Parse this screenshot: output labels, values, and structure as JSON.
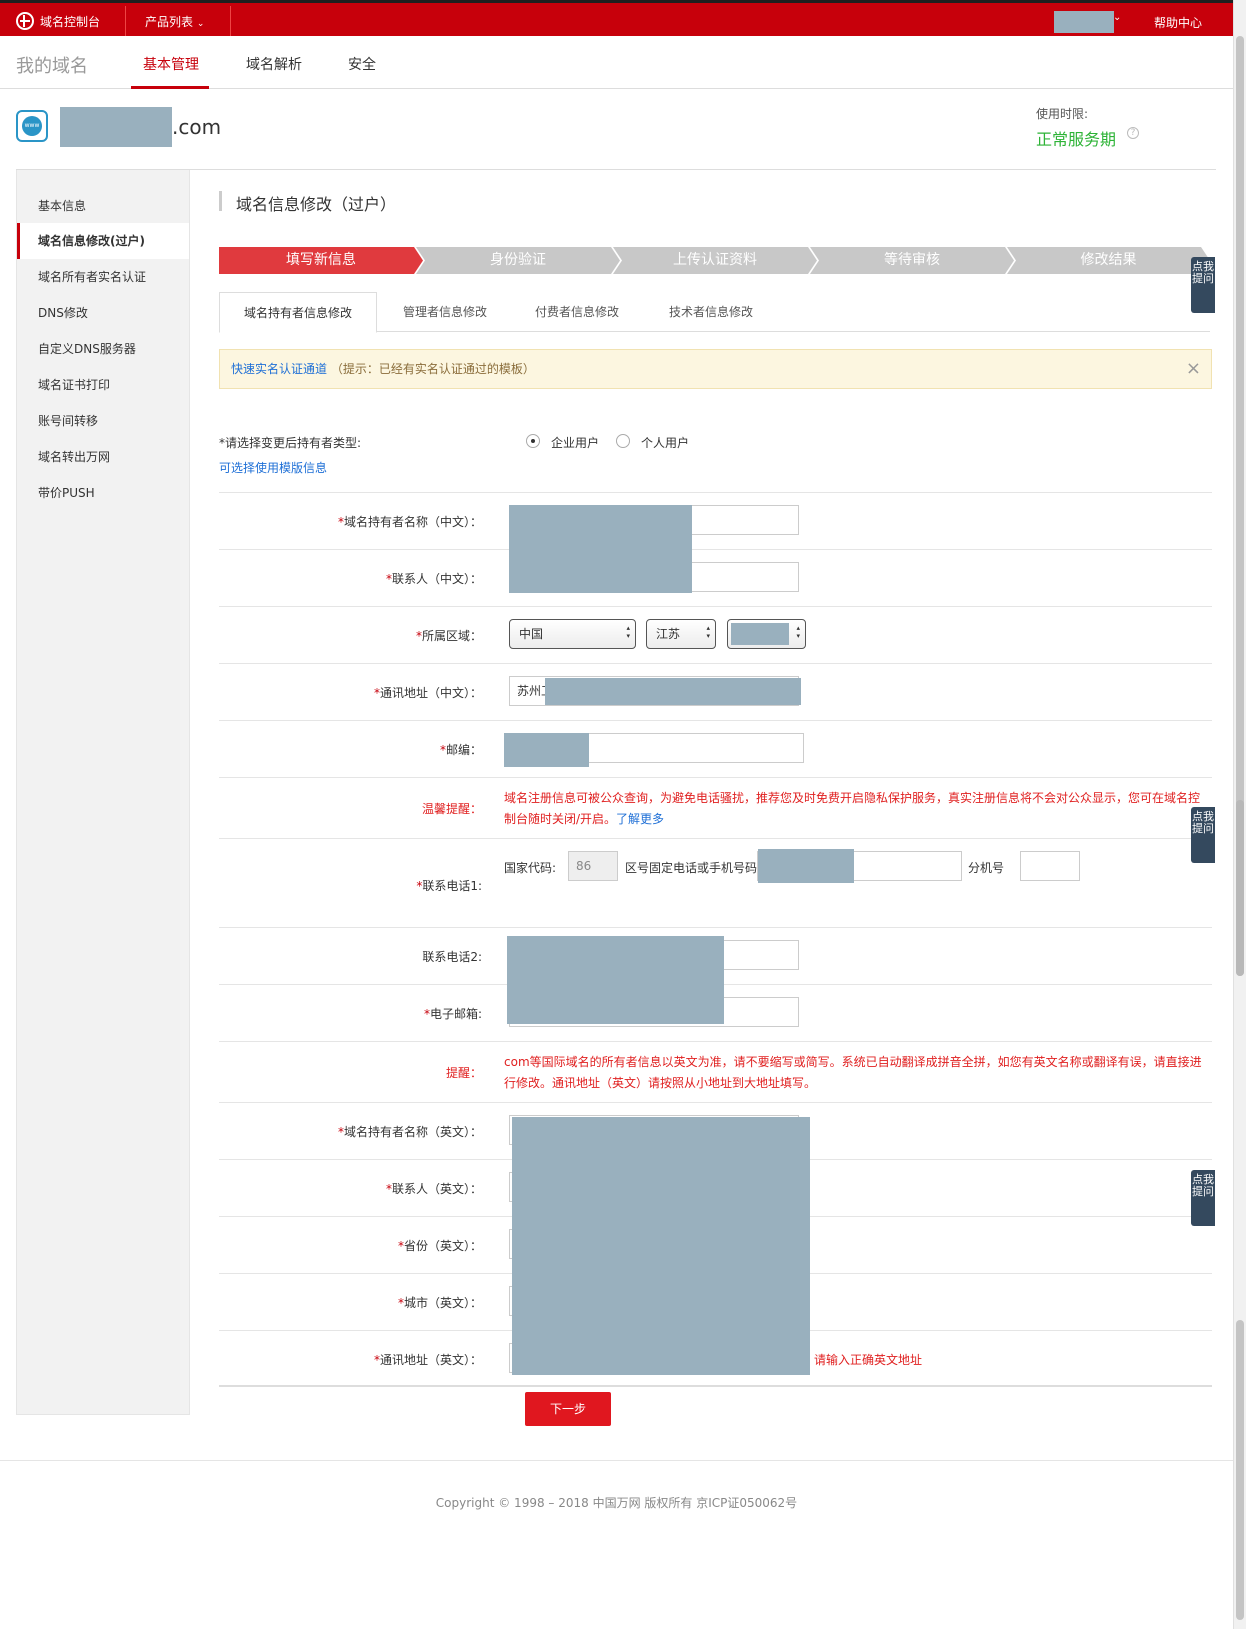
{
  "topbar": {
    "logo_label": "域名控制台",
    "products_label": "产品列表",
    "help_label": "帮助中心"
  },
  "nav": {
    "title": "我的域名",
    "tabs": [
      "基本管理",
      "域名解析",
      "安全"
    ]
  },
  "domain": {
    "suffix": ".com",
    "term_label": "使用时限:",
    "term_value": "正常服务期"
  },
  "sidebar": {
    "items": [
      "基本信息",
      "域名信息修改(过户)",
      "域名所有者实名认证",
      "DNS修改",
      "自定义DNS服务器",
      "域名证书打印",
      "账号间转移",
      "域名转出万网",
      "带价PUSH"
    ]
  },
  "main": {
    "title": "域名信息修改（过户）",
    "steps": [
      "填写新信息",
      "身份验证",
      "上传认证资料",
      "等待审核",
      "修改结果"
    ],
    "subtabs": [
      "域名持有者信息修改",
      "管理者信息修改",
      "付费者信息修改",
      "技术者信息修改"
    ],
    "notice": {
      "link": "快速实名认证通道",
      "text": "（提示：已经有实名认证通过的模板）",
      "close": "×"
    },
    "owner_type": {
      "label": "*请选择变更后持有者类型:",
      "options": [
        "企业用户",
        "个人用户"
      ],
      "template_link": "可选择使用模版信息"
    },
    "form": {
      "holder_cn": "域名持有者名称（中文）：",
      "contact_cn": "联系人（中文）：",
      "region": "所属区域：",
      "region_country": "中国",
      "region_province": "江苏",
      "address_cn": "通讯地址（中文）：",
      "address_cn_value": "苏州工",
      "zip": "邮编：",
      "tip_label": "温馨提醒：",
      "tip_text": "域名注册信息可被公众查询，为避免电话骚扰，推荐您及时免费开启隐私保护服务，真实注册信息将不会对公众显示，您可在域名控制台随时关闭/开启。",
      "tip_link": "了解更多",
      "phone1": "联系电话1:",
      "country_code_label": "国家代码:",
      "country_code": "86",
      "phone_label": "区号固定电话或手机号码",
      "ext_label": "分机号",
      "phone2": "联系电话2:",
      "email": "电子邮箱:",
      "remind_label": "提醒：",
      "remind_text": "com等国际域名的所有者信息以英文为准，请不要缩写或简写。系统已自动翻译成拼音全拼，如您有英文名称或翻译有误，请直接进行修改。通讯地址（英文）请按照从小地址到大地址填写。",
      "holder_en": "域名持有者名称（英文）：",
      "contact_en": "联系人（英文）：",
      "province_en": "省份（英文）：",
      "city_en": "城市（英文）：",
      "address_en": "通讯地址（英文）：",
      "address_en_error": "请输入正确英文地址"
    },
    "next_label": "下一步"
  },
  "float_tab": "点我提问",
  "footer": "Copyright © 1998 – 2018 中国万网 版权所有 京ICP证050062号",
  "colors": {
    "brand_red": "#c7000b",
    "mask": "#99b0be",
    "active_green": "#2db336",
    "link_blue": "#1e6fd6"
  }
}
